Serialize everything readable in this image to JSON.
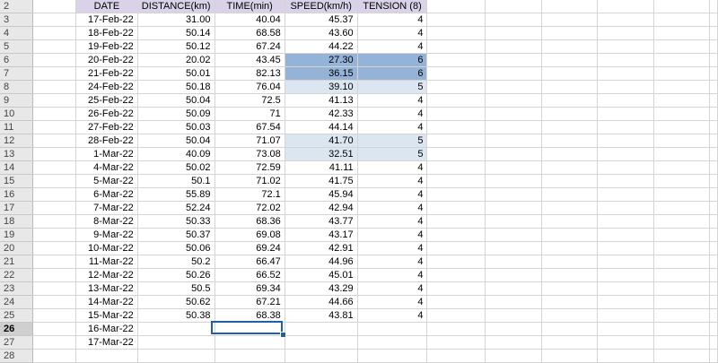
{
  "headers": [
    "DATE",
    "DISTANCE(km)",
    "TIME(min)",
    "SPEED(km/h)",
    "TENSION (8)"
  ],
  "header_row_number": "2",
  "rows": [
    {
      "n": "3",
      "date": "17-Feb-22",
      "dist": "31.00",
      "time": "40.04",
      "speed": "45.37",
      "tension": "4"
    },
    {
      "n": "4",
      "date": "18-Feb-22",
      "dist": "50.14",
      "time": "68.58",
      "speed": "43.60",
      "tension": "4"
    },
    {
      "n": "5",
      "date": "19-Feb-22",
      "dist": "50.12",
      "time": "67.24",
      "speed": "44.22",
      "tension": "4"
    },
    {
      "n": "6",
      "date": "20-Feb-22",
      "dist": "20.02",
      "time": "43.45",
      "speed": "27.30",
      "tension": "6"
    },
    {
      "n": "7",
      "date": "21-Feb-22",
      "dist": "50.01",
      "time": "82.13",
      "speed": "36.15",
      "tension": "6"
    },
    {
      "n": "8",
      "date": "24-Feb-22",
      "dist": "50.18",
      "time": "76.04",
      "speed": "39.10",
      "tension": "5"
    },
    {
      "n": "9",
      "date": "25-Feb-22",
      "dist": "50.04",
      "time": "72.5",
      "speed": "41.13",
      "tension": "4"
    },
    {
      "n": "10",
      "date": "26-Feb-22",
      "dist": "50.09",
      "time": "71",
      "speed": "42.33",
      "tension": "4"
    },
    {
      "n": "11",
      "date": "27-Feb-22",
      "dist": "50.03",
      "time": "67.54",
      "speed": "44.14",
      "tension": "4"
    },
    {
      "n": "12",
      "date": "28-Feb-22",
      "dist": "50.04",
      "time": "71.07",
      "speed": "41.70",
      "tension": "5"
    },
    {
      "n": "13",
      "date": "1-Mar-22",
      "dist": "40.09",
      "time": "73.08",
      "speed": "32.51",
      "tension": "5"
    },
    {
      "n": "14",
      "date": "4-Mar-22",
      "dist": "50.02",
      "time": "72.59",
      "speed": "41.11",
      "tension": "4"
    },
    {
      "n": "15",
      "date": "5-Mar-22",
      "dist": "50.1",
      "time": "71.02",
      "speed": "41.75",
      "tension": "4"
    },
    {
      "n": "16",
      "date": "6-Mar-22",
      "dist": "55.89",
      "time": "72.1",
      "speed": "45.94",
      "tension": "4"
    },
    {
      "n": "17",
      "date": "7-Mar-22",
      "dist": "52.24",
      "time": "72.02",
      "speed": "42.94",
      "tension": "4"
    },
    {
      "n": "18",
      "date": "8-Mar-22",
      "dist": "50.33",
      "time": "68.36",
      "speed": "43.77",
      "tension": "4"
    },
    {
      "n": "19",
      "date": "9-Mar-22",
      "dist": "50.37",
      "time": "69.08",
      "speed": "43.17",
      "tension": "4"
    },
    {
      "n": "20",
      "date": "10-Mar-22",
      "dist": "50.06",
      "time": "69.24",
      "speed": "42.91",
      "tension": "4"
    },
    {
      "n": "21",
      "date": "11-Mar-22",
      "dist": "50.2",
      "time": "66.47",
      "speed": "44.96",
      "tension": "4"
    },
    {
      "n": "22",
      "date": "12-Mar-22",
      "dist": "50.26",
      "time": "66.52",
      "speed": "45.01",
      "tension": "4"
    },
    {
      "n": "23",
      "date": "13-Mar-22",
      "dist": "50.5",
      "time": "69.34",
      "speed": "43.29",
      "tension": "4"
    },
    {
      "n": "24",
      "date": "14-Mar-22",
      "dist": "50.62",
      "time": "67.21",
      "speed": "44.66",
      "tension": "4"
    },
    {
      "n": "25",
      "date": "15-Mar-22",
      "dist": "50.38",
      "time": "68.38",
      "speed": "43.81",
      "tension": "4"
    },
    {
      "n": "26",
      "date": "16-Mar-22",
      "dist": "",
      "time": "",
      "speed": "",
      "tension": ""
    },
    {
      "n": "27",
      "date": "17-Mar-22",
      "dist": "",
      "time": "",
      "speed": "",
      "tension": ""
    },
    {
      "n": "28",
      "date": "",
      "dist": "",
      "time": "",
      "speed": "",
      "tension": ""
    }
  ],
  "selected_row": "26",
  "highlight_colors": {
    "dark": "#95b3d7",
    "light": "#dce6f1",
    "header": "#d9d2e9",
    "selection": "#1f5ea8"
  }
}
